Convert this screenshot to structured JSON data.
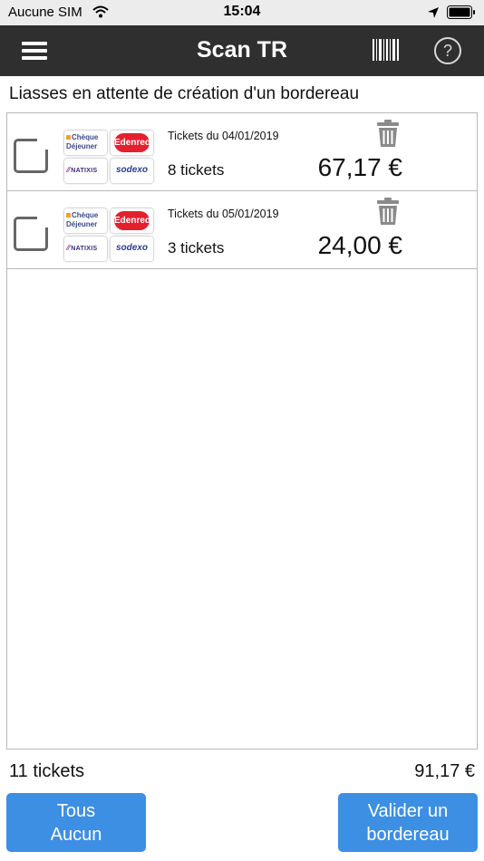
{
  "status_bar": {
    "carrier": "Aucune SIM",
    "time": "15:04"
  },
  "nav": {
    "title": "Scan TR"
  },
  "section_title": "Liasses en attente de création d'un bordereau",
  "logos": {
    "cheque_line1": "Chèque",
    "cheque_line2": "Déjeuner",
    "edenred": "Edenred",
    "natixis": "NATIXIS",
    "sodexo": "sodexo"
  },
  "batches": [
    {
      "date": "Tickets du 04/01/2019",
      "count": "8 tickets",
      "amount": "67,17 €"
    },
    {
      "date": "Tickets du 05/01/2019",
      "count": "3 tickets",
      "amount": "24,00 €"
    }
  ],
  "footer": {
    "total_count": "11 tickets",
    "total_amount": "91,17 €",
    "select_line1": "Tous",
    "select_line2": "Aucun",
    "validate_line1": "Valider un",
    "validate_line2": "bordereau"
  },
  "colors": {
    "nav_background": "#2f2f2f",
    "button_blue": "#3d8fe4",
    "edenred_red": "#e4202e"
  }
}
